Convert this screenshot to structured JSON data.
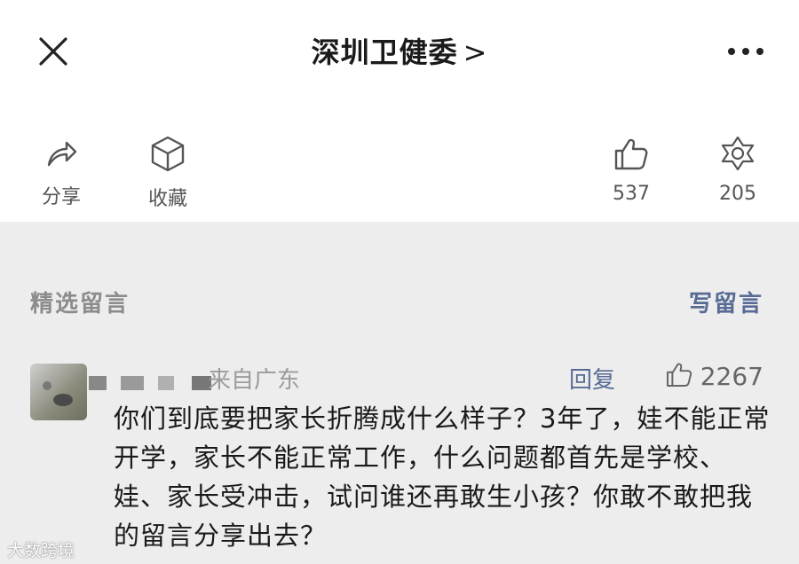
{
  "header": {
    "title": "深圳卫健委",
    "title_chevron": ">",
    "close_icon": "close-icon",
    "more_icon": "more-dots-icon"
  },
  "actions": {
    "share_label": "分享",
    "collect_label": "收藏",
    "like_count": "537",
    "wow_count": "205"
  },
  "comments": {
    "section_label": "精选留言",
    "write_label": "写留言"
  },
  "comment": {
    "location": "来自广东",
    "reply_label": "回复",
    "like_count": "2267",
    "text": "你们到底要把家长折腾成什么样子？3年了，娃不能正常开学，家长不能正常工作，什么问题都首先是学校、娃、家长受冲击，试问谁还再敢生小孩？你敢不敢把我的留言分享出去？"
  },
  "watermark": {
    "text": "大数跨境"
  },
  "colors": {
    "link": "#576b95",
    "background": "#ededed",
    "muted": "#8c8c8c"
  }
}
